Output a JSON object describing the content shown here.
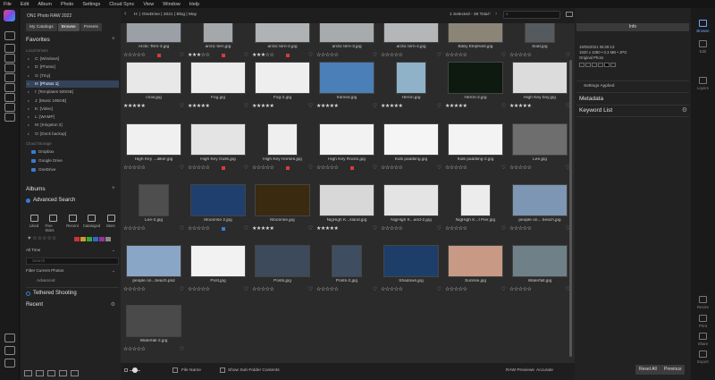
{
  "menubar": {
    "items": [
      "File",
      "Edit",
      "Album",
      "Photo",
      "Settings",
      "Cloud Sync",
      "View",
      "Window",
      "Help"
    ]
  },
  "left": {
    "app_title": "ON1 Photo RAW 2022",
    "tabs": [
      "My Catalogs",
      "Browse",
      "Presets"
    ],
    "favorites": "Favorites",
    "local_drives_label": "Local Drives",
    "drives": [
      "C: [Windows]",
      "D: [Photos]",
      "G: [Tiny]",
      "H: [Photos 1]",
      "I: [Templates 500GB]",
      "J: [Music 195GB]",
      "K: [Video]",
      "L: [WAMP]",
      "M: [Kingston 2]",
      "O: [Dock backup]"
    ],
    "cloud_label": "Cloud Storage",
    "cloud": [
      "Dropbox",
      "Google Drive",
      "OneDrive"
    ],
    "albums": "Albums",
    "advanced_search": "Advanced Search",
    "adv_items": [
      "Liked",
      "Five Stars",
      "Recent",
      "Cataloged",
      "More"
    ],
    "all_time": "All Time",
    "search_placeholder": "Search",
    "filter": "Filter Current Photos",
    "advanced": "Advanced",
    "tethered": "Tethered Shooting",
    "recent": "Recent"
  },
  "topbar": {
    "breadcrumb": "H: | OneDrive | 2021 | Blog | May",
    "selected": "1 Selected - 36 Total"
  },
  "photos": [
    {
      "name": "Arctic Tern-3.jpg",
      "stars": 0,
      "label": "#d83a3a",
      "tone": "#9aa0a6"
    },
    {
      "name": "arctic tern.jpg",
      "stars": 3,
      "label": "#d83a3a",
      "tone": "#a5a8ab"
    },
    {
      "name": "arctic tern-2.jpg",
      "stars": 3,
      "label": "#d83a3a",
      "tone": "#b0b3b5"
    },
    {
      "name": "arctic tern-3.jpg",
      "stars": 0,
      "label": "",
      "tone": "#a8abad"
    },
    {
      "name": "arctic tern-4.jpg",
      "stars": 0,
      "label": "",
      "tone": "#b4b6b8"
    },
    {
      "name": "Baby Elephant.jpg",
      "stars": 0,
      "label": "",
      "tone": "#8a8577"
    },
    {
      "name": "boat.jpg",
      "stars": 0,
      "label": "",
      "tone": "#555a5e"
    },
    {
      "name": "crow.jpg",
      "stars": 5,
      "label": "",
      "tone": "#e8e8e8"
    },
    {
      "name": "Fog.jpg",
      "stars": 5,
      "label": "",
      "tone": "#ececec"
    },
    {
      "name": "Fog-2.jpg",
      "stars": 5,
      "label": "",
      "tone": "#eeeeee"
    },
    {
      "name": "framed.jpg",
      "stars": 5,
      "label": "",
      "tone": "#4a7fb8"
    },
    {
      "name": "Heron.jpg",
      "stars": 5,
      "label": "",
      "tone": "#8fb2c9"
    },
    {
      "name": "Heron-2.jpg",
      "stars": 5,
      "label": "",
      "tone": "#0e1a10"
    },
    {
      "name": "High Key boy.jpg",
      "stars": 5,
      "label": "",
      "tone": "#dcdcdc"
    },
    {
      "name": "High Key ...alker.jpg",
      "stars": 0,
      "label": "",
      "tone": "#f0f0f0"
    },
    {
      "name": "High Key Gulls.jpg",
      "stars": 0,
      "label": "#d83a3a",
      "tone": "#e4e4e4"
    },
    {
      "name": "High Key Horses.jpg",
      "stars": 0,
      "label": "#d83a3a",
      "tone": "#efefef"
    },
    {
      "name": "High Key Rocks.jpg",
      "stars": 0,
      "label": "#d83a3a",
      "tone": "#f2f2f2"
    },
    {
      "name": "Kids paddling.jpg",
      "stars": 0,
      "label": "",
      "tone": "#f5f5f5"
    },
    {
      "name": "Kids paddling-2.jpg",
      "stars": 0,
      "label": "",
      "tone": "#f3f3f3"
    },
    {
      "name": "Lee.jpg",
      "stars": 0,
      "label": "",
      "tone": "#6e6e6e"
    },
    {
      "name": "Lee-2.jpg",
      "stars": 0,
      "label": "",
      "tone": "#4e4e4e"
    },
    {
      "name": "Moonrise 2.jpg",
      "stars": 0,
      "label": "#3a7bd5",
      "tone": "#1f3f6e"
    },
    {
      "name": "Moonrise.jpg",
      "stars": 5,
      "label": "",
      "tone": "#3a2a10"
    },
    {
      "name": "NigHigh K...sland.jpg",
      "stars": 5,
      "label": "",
      "tone": "#d8d8d8"
    },
    {
      "name": "NigHigh K...and-2.jpg",
      "stars": 0,
      "label": "",
      "tone": "#e4e4e4"
    },
    {
      "name": "NigHigh K...t Pier.jpg",
      "stars": 0,
      "label": "",
      "tone": "#ececec"
    },
    {
      "name": "people on... beach.jpg",
      "stars": 0,
      "label": "",
      "tone": "#7d96b4"
    },
    {
      "name": "people on...beach.psd",
      "stars": 0,
      "label": "",
      "tone": "#8aa6c6"
    },
    {
      "name": "Post.jpg",
      "stars": 0,
      "label": "",
      "tone": "#f2f2f2"
    },
    {
      "name": "Posts.jpg",
      "stars": 0,
      "label": "",
      "tone": "#3c4a5c"
    },
    {
      "name": "Posts-2.jpg",
      "stars": 0,
      "label": "",
      "tone": "#3f4d60"
    },
    {
      "name": "Shadows.jpg",
      "stars": 0,
      "label": "",
      "tone": "#1e3e6a"
    },
    {
      "name": "Sunrise.jpg",
      "stars": 0,
      "label": "",
      "tone": "#c89a86"
    },
    {
      "name": "Waterfall.jpg",
      "stars": 0,
      "label": "",
      "tone": "#6f8088"
    },
    {
      "name": "Waterfall-2.jpg",
      "stars": 0,
      "label": "",
      "tone": "#4a4a4a"
    }
  ],
  "status": {
    "sort": "File Name",
    "subfolder": "Show Sub-Folder Contents",
    "raw_label": "RAW Previews",
    "raw_value": "Accurate",
    "reset": "Reset All",
    "previous": "Previous"
  },
  "right": {
    "tab": "Info",
    "date": "19/05/2021 08:28:13",
    "dims": "1920 x 1080 • 0.3 MB • JPG",
    "orig": "Original Photo",
    "settings_applied": "Settings Applied",
    "metadata": "Metadata",
    "keyword_list": "Keyword List"
  },
  "modules": [
    "Browse",
    "Edit",
    "Layers",
    "Print",
    "Share",
    "Export",
    "Resize"
  ]
}
